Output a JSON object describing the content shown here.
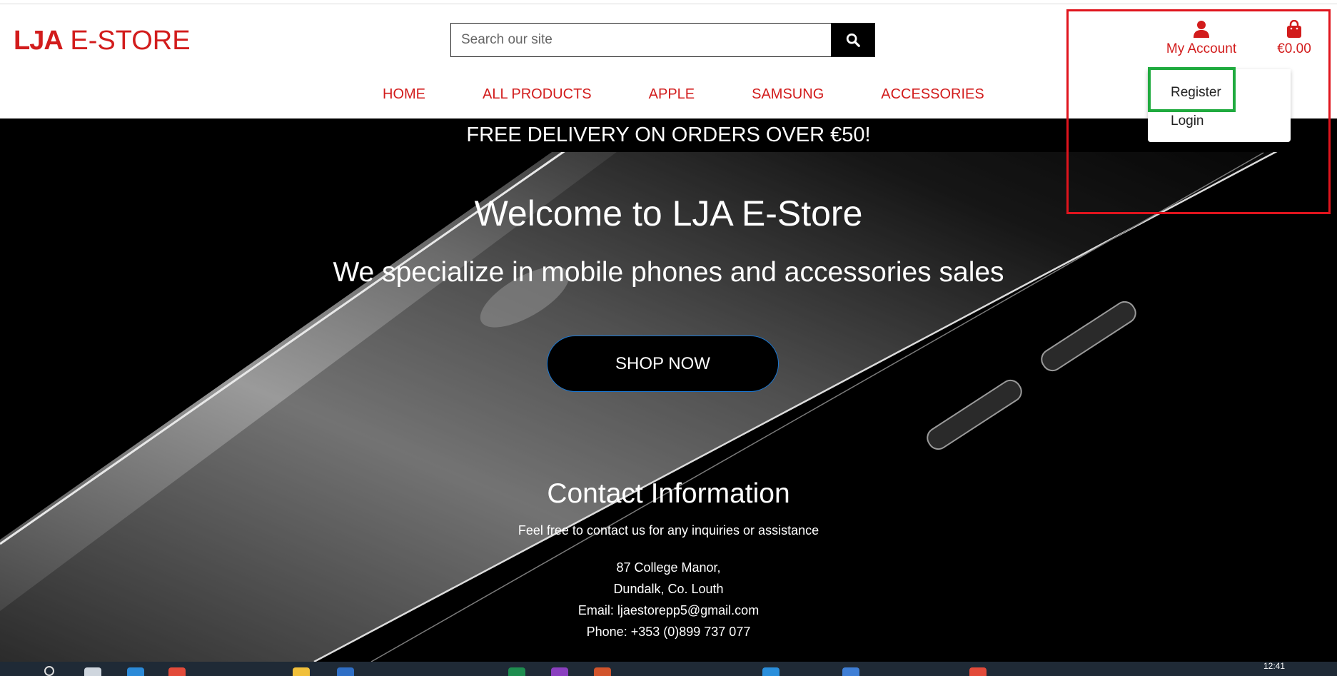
{
  "brand": {
    "logo_bold": "LJA",
    "logo_rest": " E-STORE",
    "accent_color": "#d21c1c"
  },
  "search": {
    "placeholder": "Search our site",
    "icon": "search-icon"
  },
  "account": {
    "label": "My Account",
    "icon": "user-icon"
  },
  "cart": {
    "total": "€0.00",
    "icon": "shopping-bag-icon"
  },
  "nav": {
    "items": [
      "HOME",
      "ALL PRODUCTS",
      "APPLE",
      "SAMSUNG",
      "ACCESSORIES"
    ]
  },
  "account_menu": {
    "items": [
      "Register",
      "Login"
    ]
  },
  "promo": "FREE DELIVERY ON ORDERS OVER €50!",
  "hero": {
    "title": "Welcome to LJA E-Store",
    "subtitle": "We specialize in mobile phones and accessories sales",
    "cta": "SHOP NOW"
  },
  "contact": {
    "title": "Contact Information",
    "subtitle": "Feel free to contact us for any inquiries or assistance",
    "address_line1": "87 College Manor,",
    "address_line2": "Dundalk, Co. Louth",
    "email": "Email: ljaestorepp5@gmail.com",
    "phone": "Phone: +353 (0)899 737 077"
  },
  "taskbar": {
    "time": "12:41"
  }
}
